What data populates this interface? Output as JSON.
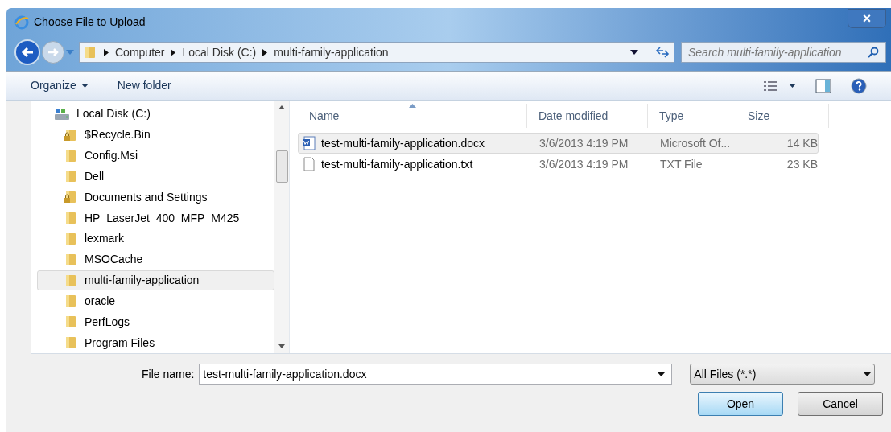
{
  "window": {
    "title": "Choose File to Upload",
    "close": "×"
  },
  "address": {
    "crumbs": [
      "Computer",
      "Local Disk (C:)",
      "multi-family-application"
    ]
  },
  "search": {
    "placeholder": "Search multi-family-application"
  },
  "toolbar": {
    "organize": "Organize",
    "new_folder": "New folder"
  },
  "sidebar": {
    "items": [
      {
        "label": "Local Disk (C:)",
        "kind": "drive",
        "selected": false
      },
      {
        "label": "$Recycle.Bin",
        "kind": "locked",
        "selected": false
      },
      {
        "label": "Config.Msi",
        "kind": "folder",
        "selected": false
      },
      {
        "label": "Dell",
        "kind": "folder",
        "selected": false
      },
      {
        "label": "Documents and Settings",
        "kind": "locked",
        "selected": false
      },
      {
        "label": "HP_LaserJet_400_MFP_M425",
        "kind": "folder",
        "selected": false
      },
      {
        "label": "lexmark",
        "kind": "folder",
        "selected": false
      },
      {
        "label": "MSOCache",
        "kind": "folder",
        "selected": false
      },
      {
        "label": "multi-family-application",
        "kind": "folder",
        "selected": true
      },
      {
        "label": "oracle",
        "kind": "folder",
        "selected": false
      },
      {
        "label": "PerfLogs",
        "kind": "folder",
        "selected": false
      },
      {
        "label": "Program Files",
        "kind": "folder",
        "selected": false
      }
    ]
  },
  "table": {
    "columns": [
      "Name",
      "Date modified",
      "Type",
      "Size"
    ],
    "rows": [
      {
        "name": "test-multi-family-application.docx",
        "kind": "word",
        "date": "3/6/2013 4:19 PM",
        "type": "Microsoft Of...",
        "size": "14 KB",
        "selected": true
      },
      {
        "name": "test-multi-family-application.txt",
        "kind": "text",
        "date": "3/6/2013 4:19 PM",
        "type": "TXT File",
        "size": "23 KB",
        "selected": false
      }
    ]
  },
  "footer": {
    "file_name_label": "File name:",
    "file_name": "test-multi-family-application.docx",
    "filter": "All Files (*.*)",
    "open": "Open",
    "cancel": "Cancel"
  }
}
